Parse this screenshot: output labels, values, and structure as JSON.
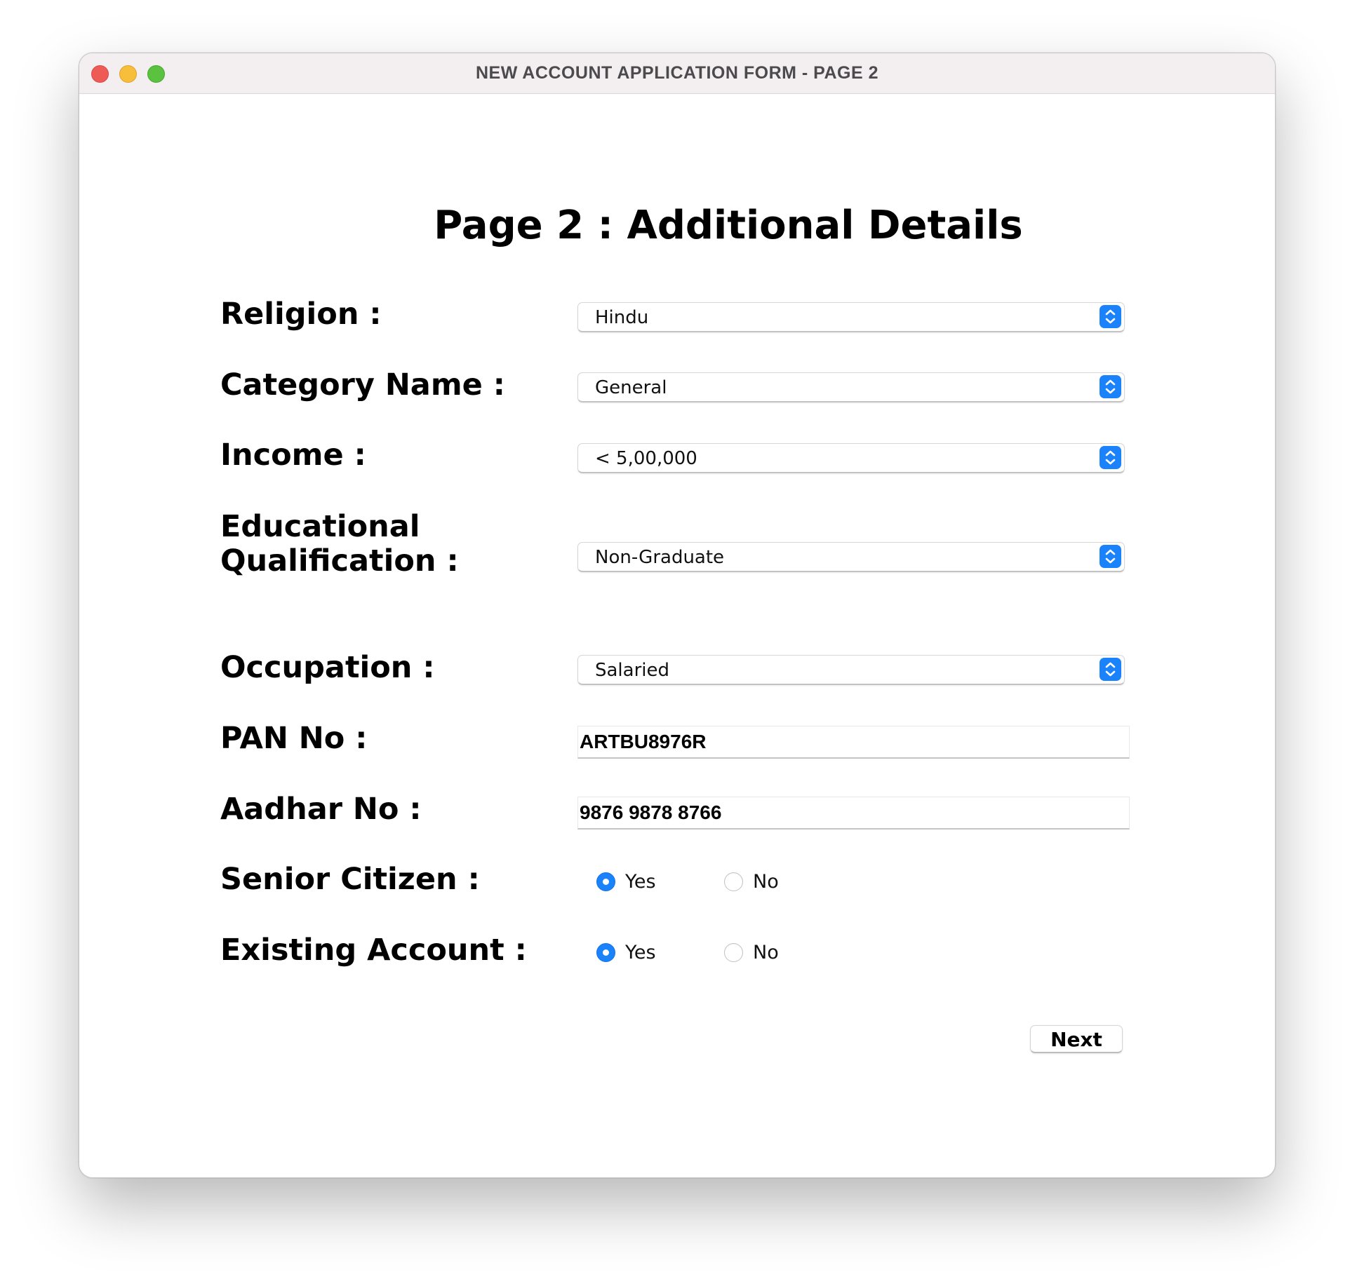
{
  "window": {
    "title": "NEW ACCOUNT APPLICATION FORM - PAGE 2"
  },
  "page": {
    "heading": "Page 2 : Additional Details"
  },
  "fields": {
    "religion": {
      "label": "Religion :",
      "value": "Hindu"
    },
    "category": {
      "label": "Category Name :",
      "value": "General"
    },
    "income": {
      "label": "Income :",
      "value": "< 5,00,000"
    },
    "education": {
      "label_line1": "Educational",
      "label_line2": "Qualification :",
      "value": "Non-Graduate"
    },
    "occupation": {
      "label": "Occupation :",
      "value": "Salaried"
    },
    "pan": {
      "label": "PAN No :",
      "value": "ARTBU8976R"
    },
    "aadhar": {
      "label": "Aadhar No :",
      "value": "9876 9878 8766"
    },
    "senior_citizen": {
      "label": "Senior Citizen :",
      "options": [
        "Yes",
        "No"
      ],
      "selected": "Yes"
    },
    "existing_account": {
      "label": "Existing Account :",
      "options": [
        "Yes",
        "No"
      ],
      "selected": "Yes"
    }
  },
  "actions": {
    "next_label": "Next"
  },
  "colors": {
    "accent": "#1a82fb",
    "titlebar": "#f3eef0",
    "close": "#ee5b56",
    "minimize": "#f6be3b",
    "maximize": "#5ac23f"
  },
  "icons": {
    "dropdown": "up-down-chevron-icon"
  }
}
